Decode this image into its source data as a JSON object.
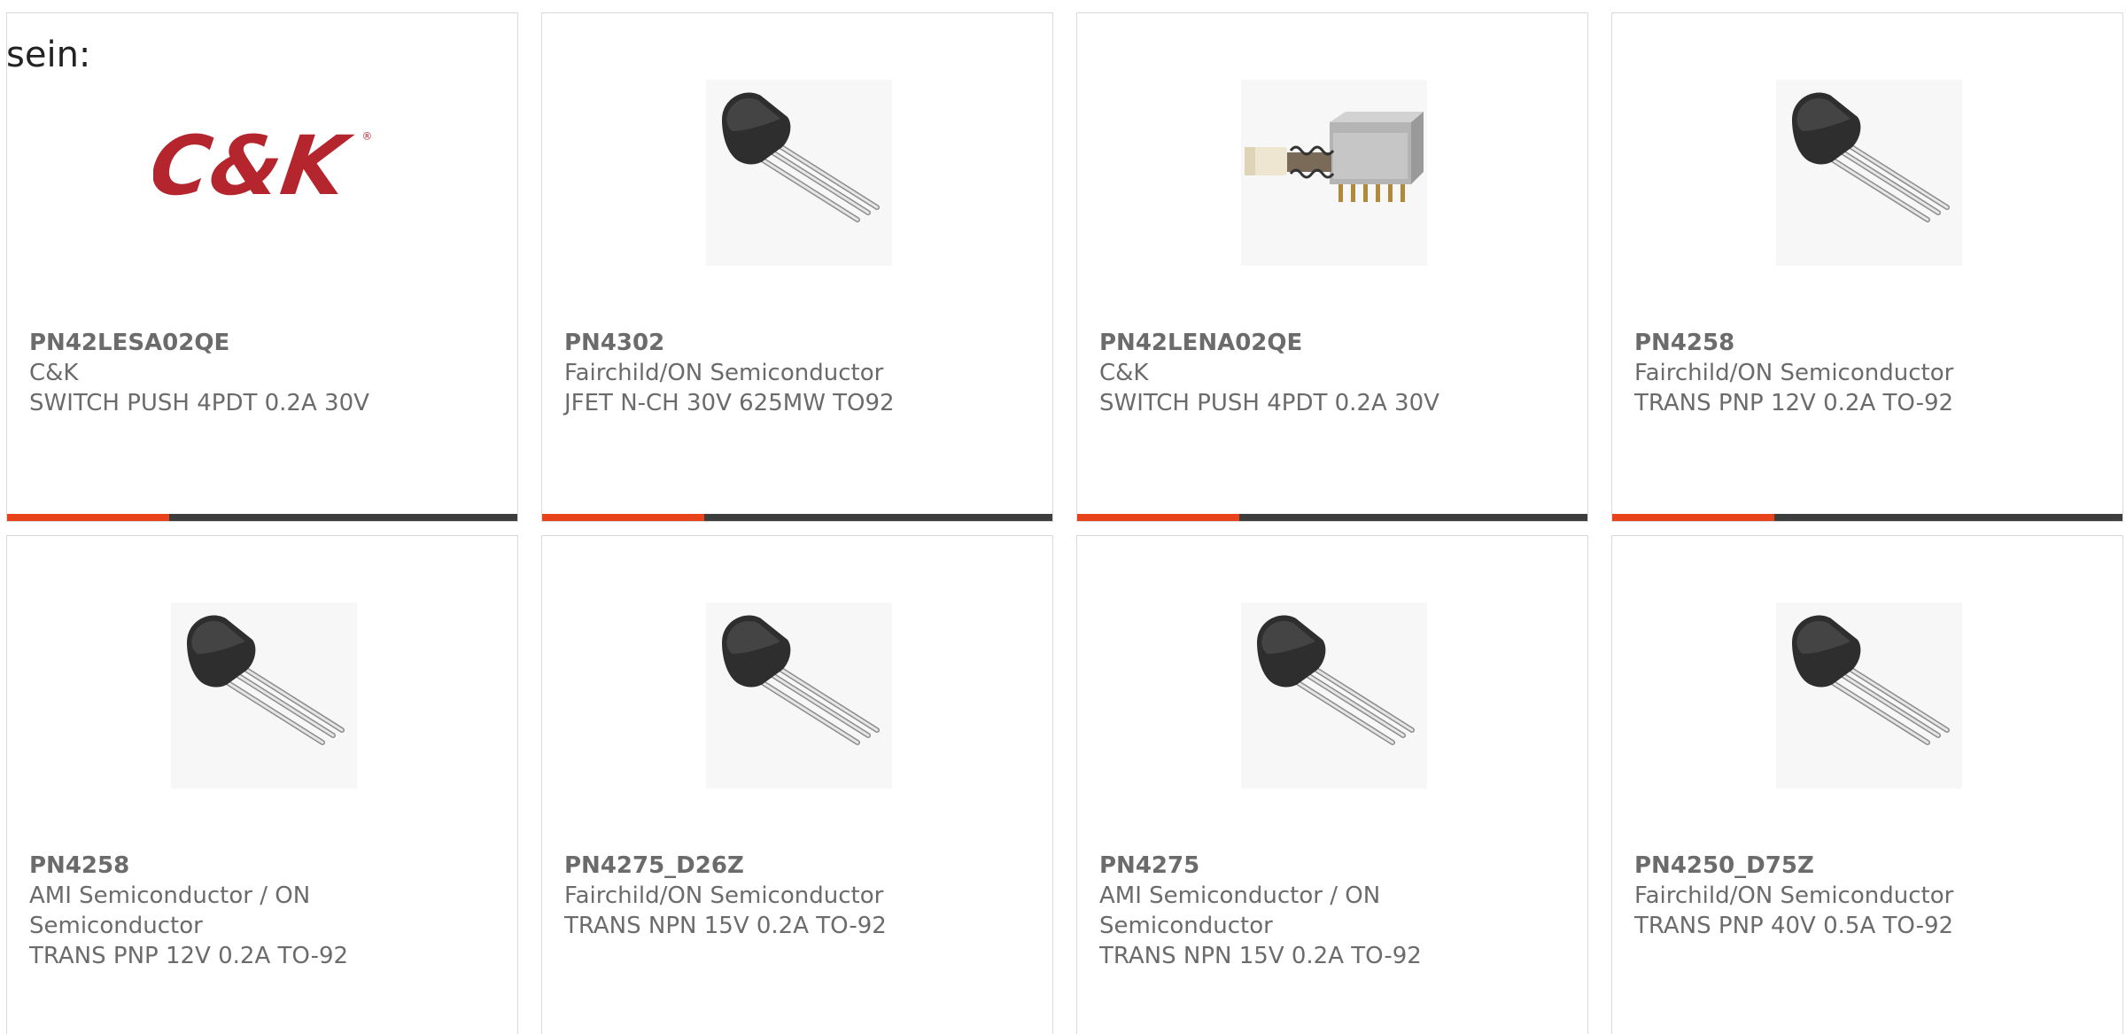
{
  "lead_text": "sein:",
  "accent_color": "#e8421a",
  "bar_color": "#3d3d3d",
  "cards": [
    {
      "part_number": "PN42LESA02QE",
      "manufacturer": "C&K",
      "description": "SWITCH PUSH 4PDT 0.2A 30V",
      "image": "ck-logo",
      "logo_text": "C&K"
    },
    {
      "part_number": "PN4302",
      "manufacturer": "Fairchild/ON Semiconductor",
      "description": "JFET N-CH 30V 625MW TO92",
      "image": "to92-transistor"
    },
    {
      "part_number": "PN42LENA02QE",
      "manufacturer": "C&K",
      "description": "SWITCH PUSH 4PDT 0.2A 30V",
      "image": "push-switch"
    },
    {
      "part_number": "PN4258",
      "manufacturer": "Fairchild/ON Semiconductor",
      "description": "TRANS PNP 12V 0.2A TO-92",
      "image": "to92-transistor"
    },
    {
      "part_number": "PN4258",
      "manufacturer": "AMI Semiconductor / ON Semiconductor",
      "description": "TRANS PNP 12V 0.2A TO-92",
      "image": "to92-transistor"
    },
    {
      "part_number": "PN4275_D26Z",
      "manufacturer": "Fairchild/ON Semiconductor",
      "description": "TRANS NPN 15V 0.2A TO-92",
      "image": "to92-transistor"
    },
    {
      "part_number": "PN4275",
      "manufacturer": "AMI Semiconductor / ON Semiconductor",
      "description": "TRANS NPN 15V 0.2A TO-92",
      "image": "to92-transistor"
    },
    {
      "part_number": "PN4250_D75Z",
      "manufacturer": "Fairchild/ON Semiconductor",
      "description": "TRANS PNP 40V 0.5A TO-92",
      "image": "to92-transistor"
    }
  ]
}
